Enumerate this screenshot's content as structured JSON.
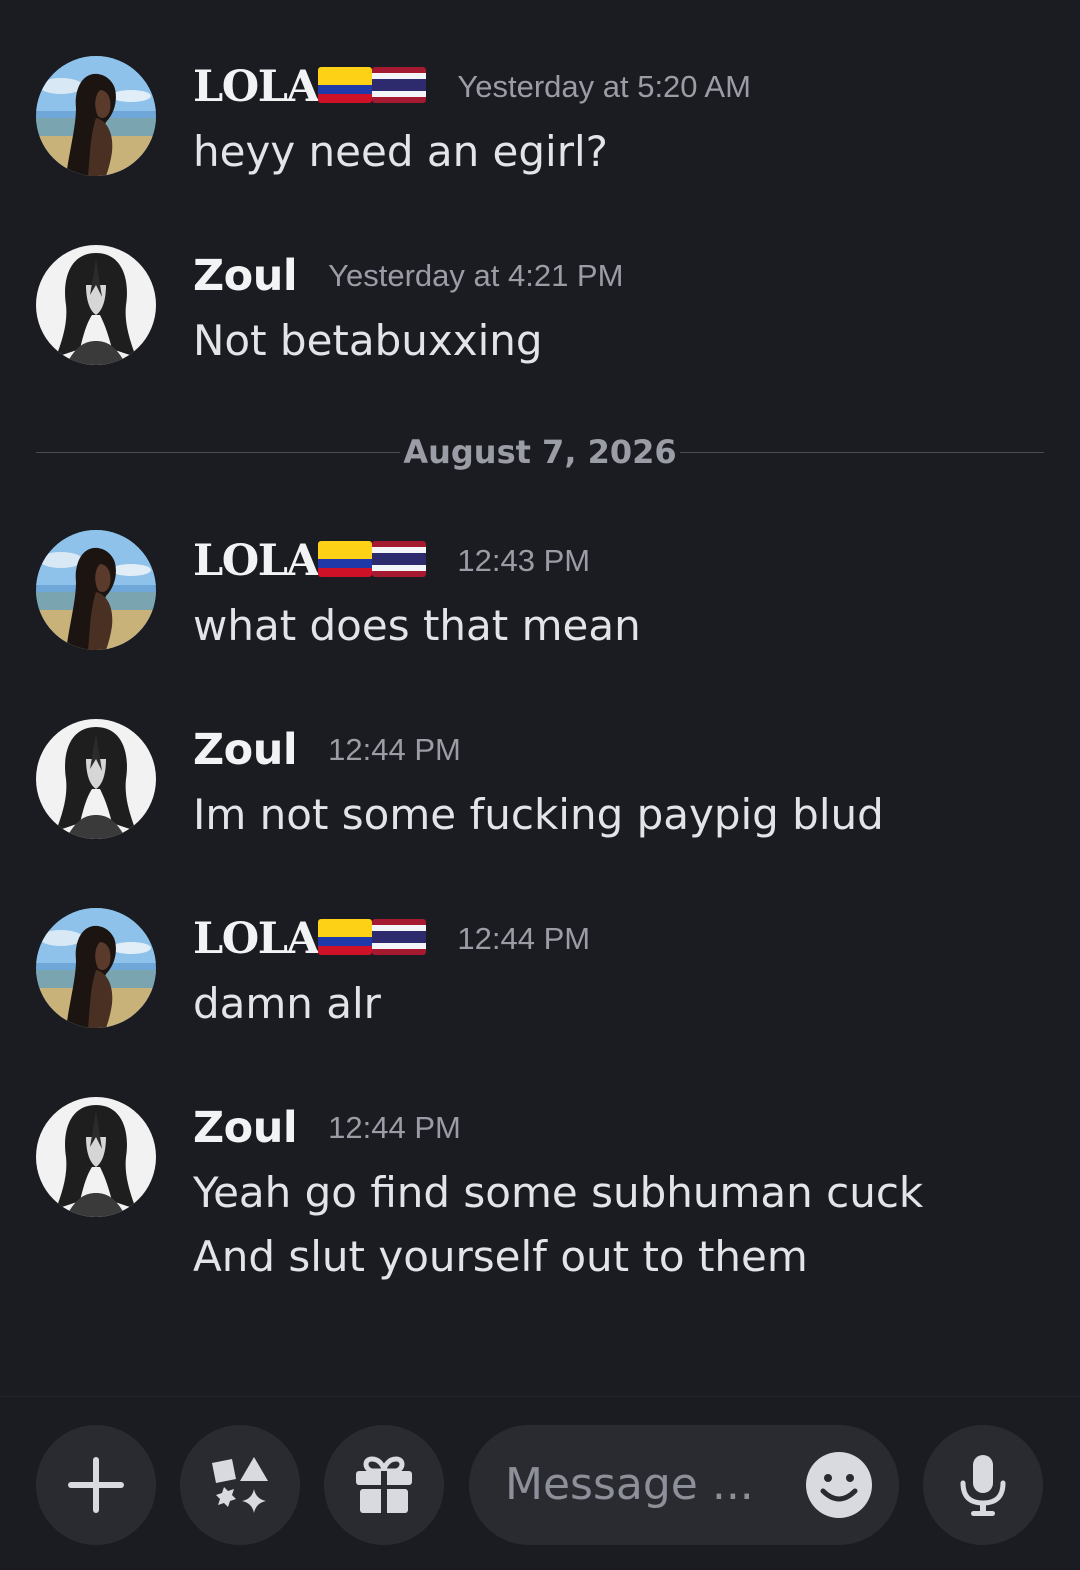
{
  "colors": {
    "background": "#1b1c21",
    "button": "#2a2b31",
    "muted": "#9a9ca6"
  },
  "divider": {
    "date": "August 7, 2026"
  },
  "messages": [
    {
      "author": "LOLA",
      "time": "Yesterday at 5:20 AM",
      "lines": [
        "heyy need an egirl?"
      ]
    },
    {
      "author": "Zoul",
      "time": "Yesterday at 4:21 PM",
      "lines": [
        "Not betabuxxing"
      ]
    },
    {
      "author": "LOLA",
      "time": "12:43 PM",
      "lines": [
        "what does that mean"
      ]
    },
    {
      "author": "Zoul",
      "time": "12:44 PM",
      "lines": [
        "Im not some fucking paypig blud"
      ]
    },
    {
      "author": "LOLA",
      "time": "12:44 PM",
      "lines": [
        "damn alr"
      ]
    },
    {
      "author": "Zoul",
      "time": "12:44 PM",
      "lines": [
        "Yeah go find some subhuman cuck",
        "And slut yourself out to them"
      ]
    }
  ],
  "author_flags": [
    "colombia-flag-icon",
    "thailand-flag-icon"
  ],
  "composer": {
    "placeholder": "Message ...",
    "icons": [
      "plus-icon",
      "apps-icon",
      "gift-icon",
      "emoji-icon",
      "microphone-icon"
    ]
  }
}
